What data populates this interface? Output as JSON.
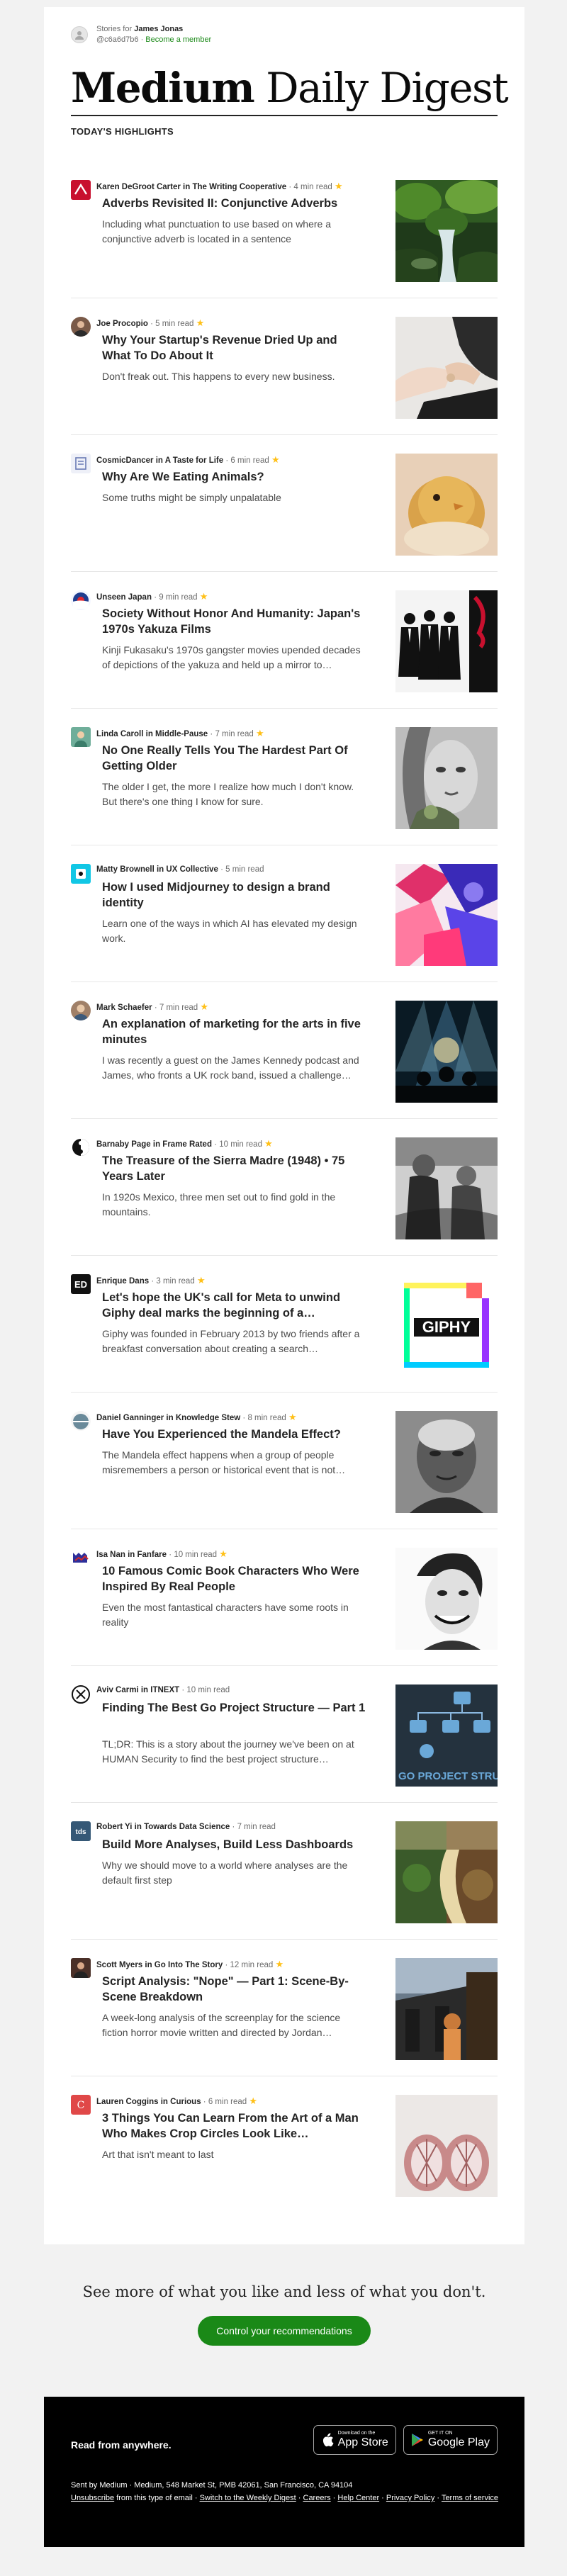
{
  "header": {
    "stories_for_prefix": "Stories for",
    "user_name": "James Jonas",
    "user_handle": "@c6a6d7b6",
    "sep": "·",
    "become_member": "Become a member",
    "masthead_bold": "Medium",
    "masthead_rest": " Daily Digest",
    "highlights": "TODAY'S HIGHLIGHTS"
  },
  "stories": [
    {
      "author": "Karen DeGroot Carter in The Writing Cooperative",
      "sep": "·",
      "read": "4 min read",
      "star": "★",
      "title": "Adverbs Revisited II: Conjunctive Adverbs",
      "subtitle": "Including what punctuation to use based on where a conjunctive adverb is located in a sentence"
    },
    {
      "author": "Joe Procopio",
      "sep": "·",
      "read": "5 min read",
      "star": "★",
      "title": "Why Your Startup's Revenue Dried Up and What To Do About It",
      "subtitle": "Don't freak out. This happens to every new business."
    },
    {
      "author": "CosmicDancer in A Taste for Life",
      "sep": "·",
      "read": "6 min read",
      "star": "★",
      "title": "Why Are We Eating Animals?",
      "subtitle": "Some truths might be simply unpalatable"
    },
    {
      "author": "Unseen Japan",
      "sep": "·",
      "read": "9 min read",
      "star": "★",
      "title": "Society Without Honor And Humanity: Japan's 1970s Yakuza Films",
      "subtitle": "Kinji Fukasaku's 1970s gangster movies upended decades of depictions of the yakuza and held up a mirror to…"
    },
    {
      "author": "Linda Caroll in Middle-Pause",
      "sep": "·",
      "read": "7 min read",
      "star": "★",
      "title": "No One Really Tells You The Hardest Part Of Getting Older",
      "subtitle": "The older I get, the more I realize how much I don't know. But there's one thing I know for sure."
    },
    {
      "author": "Matty Brownell in UX Collective",
      "sep": "·",
      "read": "5 min read",
      "star": "",
      "title": "How I used Midjourney to design a brand identity",
      "subtitle": "Learn one of the ways in which AI has elevated my design work."
    },
    {
      "author": "Mark Schaefer",
      "sep": "·",
      "read": "7 min read",
      "star": "★",
      "title": "An explanation of marketing for the arts in five minutes",
      "subtitle": "I was recently a guest on the James Kennedy podcast and James, who fronts a UK rock band, issued a challenge…"
    },
    {
      "author": "Barnaby Page in Frame Rated",
      "sep": "·",
      "read": "10 min read",
      "star": "★",
      "title": "The Treasure of the Sierra Madre (1948) • 75 Years Later",
      "subtitle": "In 1920s Mexico, three men set out to find gold in the mountains."
    },
    {
      "author": "Enrique Dans",
      "sep": "·",
      "read": "3 min read",
      "star": "★",
      "title": "Let's hope the UK's call for Meta to unwind Giphy deal marks the beginning of a…",
      "subtitle": "Giphy was founded in February 2013 by two friends after a breakfast conversation about creating a search…"
    },
    {
      "author": "Daniel Ganninger in Knowledge Stew",
      "sep": "·",
      "read": "8 min read",
      "star": "★",
      "title": "Have You Experienced the Mandela Effect?",
      "subtitle": "The Mandela effect happens when a group of people misremembers a person or historical event that is not…"
    },
    {
      "author": "Isa Nan in Fanfare",
      "sep": "·",
      "read": "10 min read",
      "star": "★",
      "title": "10 Famous Comic Book Characters Who Were Inspired By Real People",
      "subtitle": "Even the most fantastical characters have some roots in reality"
    },
    {
      "author": "Aviv Carmi in ITNEXT",
      "sep": "·",
      "read": "10 min read",
      "star": "",
      "title": "Finding The Best Go Project Structure — Part 1",
      "subtitle": "TL;DR: This is a story about the journey we've been on at HUMAN Security to find the best project structure…"
    },
    {
      "author": "Robert Yi in Towards Data Science",
      "sep": "·",
      "read": "7 min read",
      "star": "",
      "title": "Build More Analyses, Build Less Dashboards",
      "subtitle": "Why we should move to a world where analyses are the default first step"
    },
    {
      "author": "Scott Myers in Go Into The Story",
      "sep": "·",
      "read": "12 min read",
      "star": "★",
      "title": "Script Analysis: \"Nope\" — Part 1: Scene-By-Scene Breakdown",
      "subtitle": "A week-long analysis of the screenplay for the science fiction horror movie written and directed by Jordan…"
    },
    {
      "author": "Lauren Coggins in Curious",
      "sep": "·",
      "read": "6 min read",
      "star": "★",
      "title": "3 Things You Can Learn From the Art of a Man Who Makes Crop Circles Look Like…",
      "subtitle": "Art that isn't meant to last"
    }
  ],
  "images": {
    "giphy_text": "GIPHY",
    "go_text": "GO PROJECT STRUC",
    "tds_text": "tds",
    "ed_text": "ED"
  },
  "footer": {
    "see_more": "See more of what you like and less of what you don't.",
    "control_button": "Control your recommendations",
    "read_anywhere": "Read from anywhere.",
    "appstore_small": "Download on the",
    "appstore_big": "App Store",
    "gplay_small": "GET IT ON",
    "gplay_big": "Google Play",
    "sent_by": "Sent by Medium · Medium, 548 Market St, PMB 42061, San Francisco, CA 94104",
    "unsubscribe": "Unsubscribe",
    "from_type": " from this type of email · ",
    "switch_weekly": "Switch to the Weekly Digest",
    "dot1": " · ",
    "careers": "Careers",
    "dot2": " · ",
    "help": "Help Center",
    "dot3": " · ",
    "privacy": "Privacy Policy",
    "dot4": " · ",
    "terms": "Terms of service"
  },
  "colors": {
    "accent_green": "#1a8917",
    "star": "#ffc017",
    "text": "#242424"
  }
}
